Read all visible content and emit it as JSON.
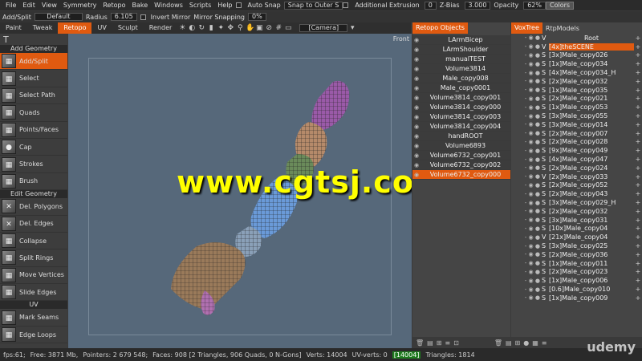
{
  "menu": {
    "items": [
      "File",
      "Edit",
      "View",
      "Symmetry",
      "Retopo",
      "Bake",
      "Windows",
      "Scripts",
      "Help"
    ],
    "auto_snap_label": "Auto Snap",
    "snap_mode": "Snap to Outer S",
    "additional_extrusion_label": "Additional Extrusion",
    "additional_extrusion_value": "0",
    "zbias_label": "Z-Bias",
    "zbias_value": "3.000",
    "opacity_label": "Opacity",
    "opacity_value": "62%",
    "colors_label": "Colors"
  },
  "toolbar": {
    "mode_label": "Add/Split",
    "preset_value": "Default",
    "radius_label": "Radius",
    "radius_value": "6.105",
    "invert_mirror_label": "Invert Mirror",
    "mirror_snapping_label": "Mirror Snapping",
    "mirror_snapping_value": "0%"
  },
  "room_tabs": [
    "Paint",
    "Tweak",
    "Retopo",
    "UV",
    "Sculpt",
    "Render"
  ],
  "active_room": "Retopo",
  "camera_value": "[Camera]",
  "left_panel": {
    "icon_label": "T",
    "sections": [
      {
        "title": "Add Geometry",
        "tools": [
          "Add/Split",
          "Select",
          "Select Path",
          "Quads",
          "Points/Faces",
          "Cap",
          "Strokes",
          "Brush"
        ]
      },
      {
        "title": "Edit Geometry",
        "tools": [
          "Del. Polygons",
          "Del. Edges",
          "Collapse",
          "Split Rings",
          "Move Vertices",
          "Slide Edges"
        ]
      },
      {
        "title": "UV",
        "tools": [
          "Mark Seams",
          "Edge Loops"
        ]
      }
    ],
    "active_tool": "Add/Split"
  },
  "viewport": {
    "view_label": "Front",
    "watermark": "www.cgtsj.com"
  },
  "retopo_objects": {
    "title": "Retopo Objects",
    "items": [
      "LArmBicep",
      "LArmShoulder",
      "manualTEST",
      "Volume3814",
      "Male_copy008",
      "Male_copy0001",
      "Volume3814_copy001",
      "Volume3814_copy000",
      "Volume3814_copy003",
      "Volume3814_copy004",
      "handROOT",
      "Volume6893",
      "Volume6732_copy001",
      "Volume6732_copy002",
      "Volume6732_copy000"
    ],
    "selected": "Volume6732_copy000"
  },
  "voxtree": {
    "tabs": [
      "VoxTree",
      "RtpModels"
    ],
    "root_type": "V",
    "root_label": "Root",
    "scene_label": "[4x]theSCENE",
    "items": [
      {
        "t": "S",
        "label": "[3x]Male_copy026"
      },
      {
        "t": "S",
        "label": "[1x]Male_copy034"
      },
      {
        "t": "S",
        "label": "[4x]Male_copy034_H"
      },
      {
        "t": "S",
        "label": "[2x]Male_copy032"
      },
      {
        "t": "S",
        "label": "[1x]Male_copy035"
      },
      {
        "t": "S",
        "label": "[2x]Male_copy021"
      },
      {
        "t": "S",
        "label": "[1x]Male_copy053"
      },
      {
        "t": "S",
        "label": "[3x]Male_copy055"
      },
      {
        "t": "S",
        "label": "[3x]Male_copy014"
      },
      {
        "t": "S",
        "label": "[2x]Male_copy007"
      },
      {
        "t": "S",
        "label": "[2x]Male_copy028"
      },
      {
        "t": "S",
        "label": "[9x]Male_copy049"
      },
      {
        "t": "S",
        "label": "[4x]Male_copy047"
      },
      {
        "t": "S",
        "label": "[2x]Male_copy024"
      },
      {
        "t": "V",
        "label": "[2x]Male_copy033"
      },
      {
        "t": "S",
        "label": "[2x]Male_copy052"
      },
      {
        "t": "S",
        "label": "[2x]Male_copy043"
      },
      {
        "t": "S",
        "label": "[3x]Male_copy029_H"
      },
      {
        "t": "S",
        "label": "[2x]Male_copy032"
      },
      {
        "t": "S",
        "label": "[3x]Male_copy031"
      },
      {
        "t": "S",
        "label": "[10x]Male_copy04"
      },
      {
        "t": "V",
        "label": "[21x]Male_copy04"
      },
      {
        "t": "S",
        "label": "[3x]Male_copy025"
      },
      {
        "t": "S",
        "label": "[2x]Male_copy036"
      },
      {
        "t": "S",
        "label": "[1x]Male_copy011"
      },
      {
        "t": "S",
        "label": "[2x]Male_copy023"
      },
      {
        "t": "S",
        "label": "[1x]Male_copy006"
      },
      {
        "t": "S",
        "label": "[0.6]Male_copy010"
      },
      {
        "t": "S",
        "label": "[1x]Male_copy009"
      }
    ]
  },
  "status": {
    "fps": "fps:61;",
    "free": "Free: 3871 Mb,",
    "points": "Pointers: 2 679 548;",
    "faces": "Faces: 908 [2 Triangles, 906 Quads, 0 N-Gons]",
    "verts": "Verts: 14004",
    "uv_verts": "UV-verts: 0",
    "uv_highlight": "[14004]",
    "triangles": "Triangles: 1814"
  },
  "brand": "udemy",
  "colors": {
    "accent": "#e05a10",
    "watermark": "#ffff00",
    "viewport": "#56687a"
  }
}
